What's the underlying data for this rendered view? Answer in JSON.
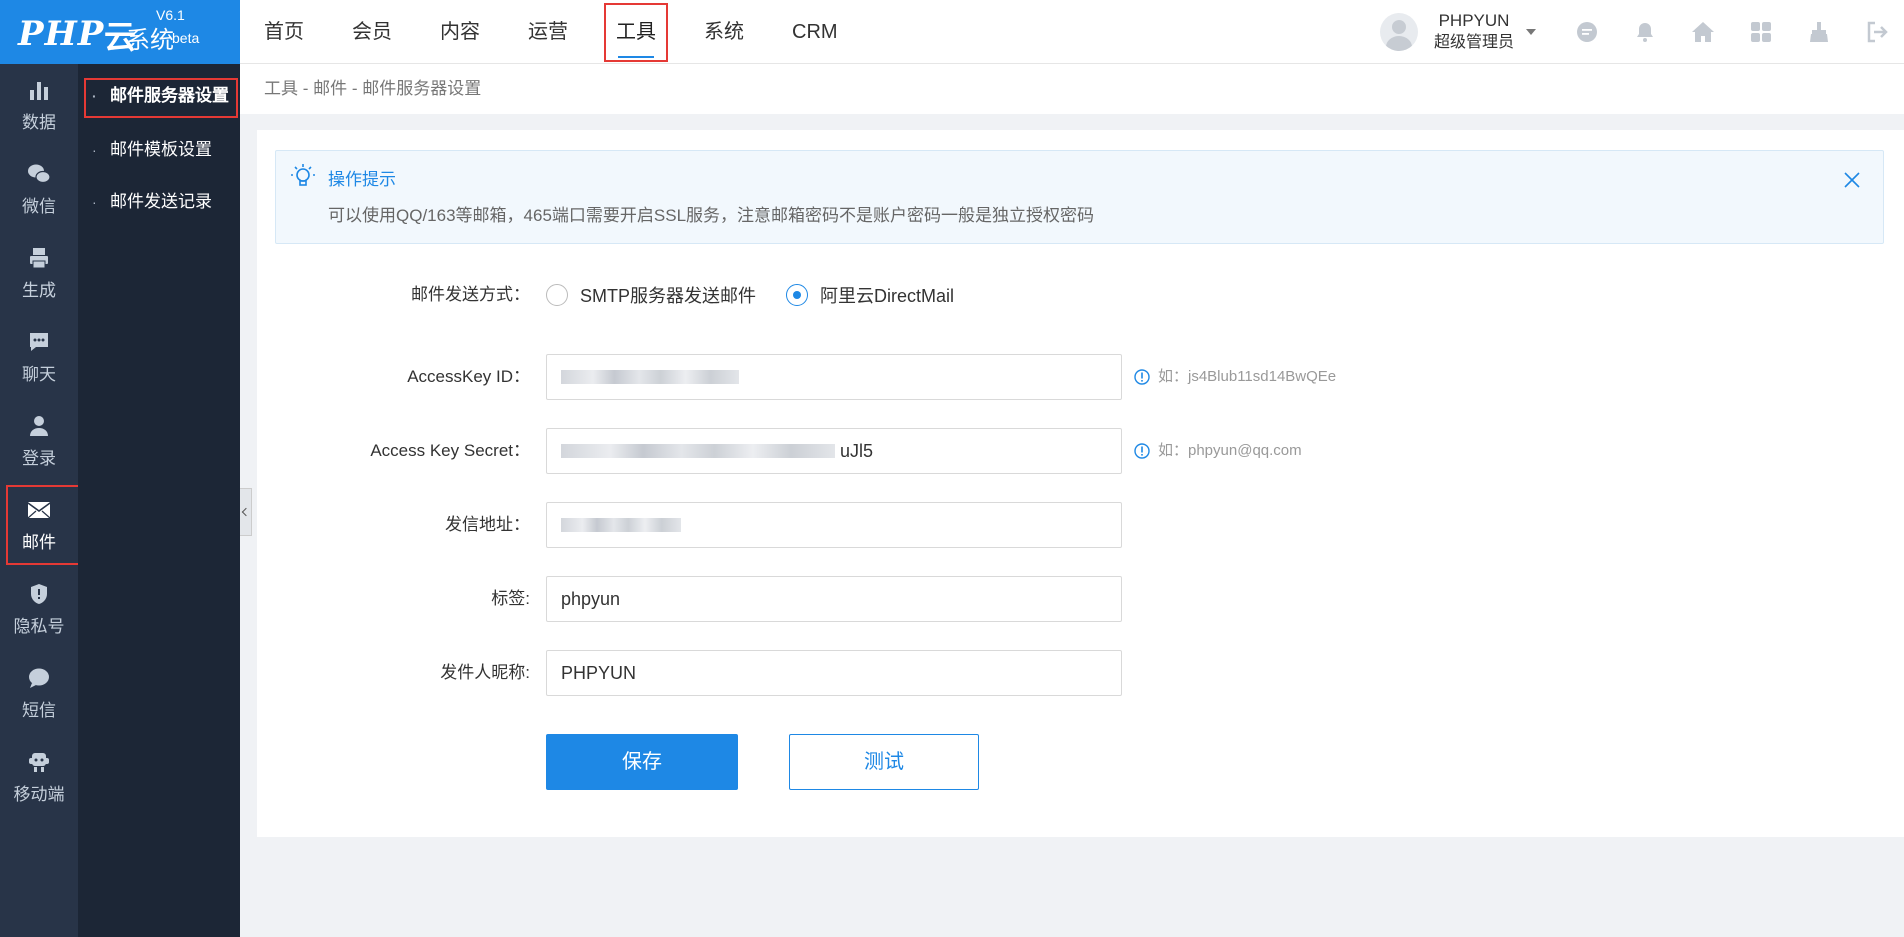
{
  "logo": {
    "php": "PHP",
    "cloud": "云",
    "system": "系统",
    "version": "V6.1",
    "beta": "beta"
  },
  "topnav": [
    {
      "label": "首页"
    },
    {
      "label": "会员"
    },
    {
      "label": "内容"
    },
    {
      "label": "运营"
    },
    {
      "label": "工具"
    },
    {
      "label": "系统"
    },
    {
      "label": "CRM"
    }
  ],
  "topnav_active": "工具",
  "user": {
    "name": "PHPYUN",
    "role": "超级管理员"
  },
  "top_icons": [
    "chat-bubble-icon",
    "bell-icon",
    "home-icon",
    "grid-icon",
    "broom-icon",
    "logout-icon"
  ],
  "sidebar": [
    {
      "label": "数据",
      "icon": "bar-chart-icon"
    },
    {
      "label": "微信",
      "icon": "wechat-icon"
    },
    {
      "label": "生成",
      "icon": "print-icon"
    },
    {
      "label": "聊天",
      "icon": "chat-icon"
    },
    {
      "label": "登录",
      "icon": "user-icon"
    },
    {
      "label": "邮件",
      "icon": "mail-icon"
    },
    {
      "label": "隐私号",
      "icon": "shield-icon"
    },
    {
      "label": "短信",
      "icon": "message-icon"
    },
    {
      "label": "移动端",
      "icon": "mobile-icon"
    }
  ],
  "sidebar_active": "邮件",
  "submenu": [
    {
      "label": "邮件服务器设置"
    },
    {
      "label": "邮件模板设置"
    },
    {
      "label": "邮件发送记录"
    }
  ],
  "breadcrumb": "工具 - 邮件 - 邮件服务器设置",
  "tip": {
    "title": "操作提示",
    "text": "可以使用QQ/163等邮箱，465端口需要开启SSL服务，注意邮箱密码不是账户密码一般是独立授权密码"
  },
  "form": {
    "send_method_label": "邮件发送方式：",
    "send_options": [
      "SMTP服务器发送邮件",
      "阿里云DirectMail"
    ],
    "send_selected": "阿里云DirectMail",
    "access_key_id_label": "AccessKey ID：",
    "access_key_id_hint": "如：js4Blub11sd14BwQEe",
    "access_key_secret_label": "Access Key Secret：",
    "access_key_secret_visible": "uJl5",
    "access_key_secret_hint": "如：phpyun@qq.com",
    "from_address_label": "发信地址：",
    "tag_label": "标签:",
    "tag_value": "phpyun",
    "nickname_label": "发件人昵称:",
    "nickname_value": "PHPYUN",
    "save_label": "保存",
    "test_label": "测试"
  },
  "colors": {
    "brand": "#1e88e5",
    "sidebar": "#283448",
    "submenu": "#1c2636",
    "highlight": "#e53935"
  }
}
